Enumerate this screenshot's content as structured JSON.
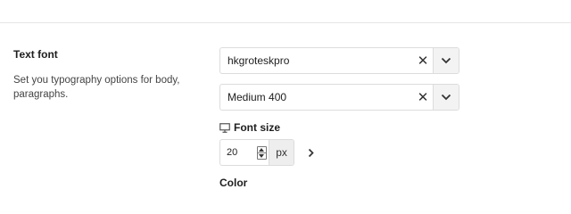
{
  "text_font": {
    "title": "Text font",
    "description": "Set you typography options for body, paragraphs."
  },
  "font_family_select": {
    "value": "hkgroteskpro",
    "clear_icon": "close-icon",
    "toggle_icon": "chevron-down-icon"
  },
  "font_weight_select": {
    "value": "Medium 400",
    "clear_icon": "close-icon",
    "toggle_icon": "chevron-down-icon"
  },
  "font_size": {
    "label": "Font size",
    "device_icon": "desktop-icon",
    "value": "20",
    "unit": "px",
    "expand_icon": "chevron-right-icon"
  },
  "next_section": {
    "label": "Color"
  }
}
